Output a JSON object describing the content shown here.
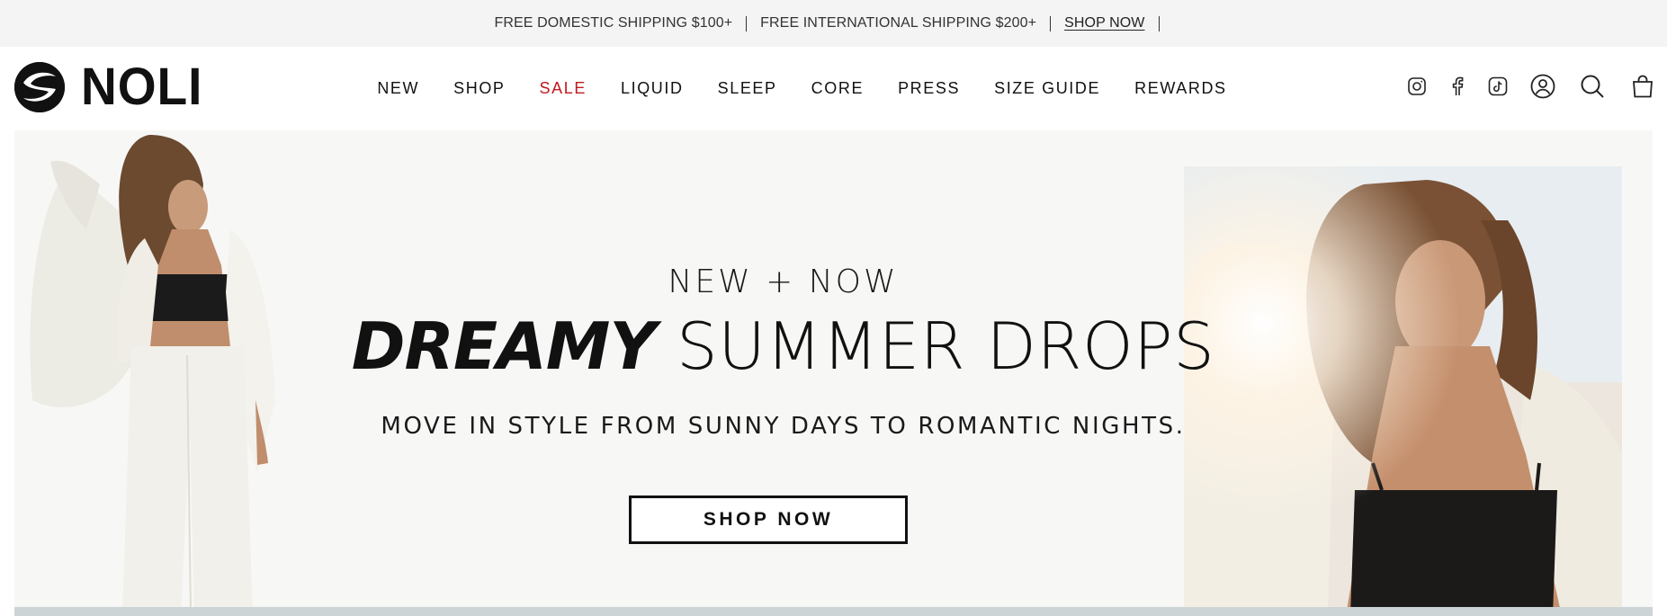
{
  "announcement": {
    "domestic": "FREE DOMESTIC SHIPPING $100+",
    "international": "FREE INTERNATIONAL SHIPPING $200+",
    "link": "SHOP NOW"
  },
  "header": {
    "logo_text": "NOLI",
    "nav": [
      "NEW",
      "SHOP",
      "SALE",
      "LIQUID",
      "SLEEP",
      "CORE",
      "PRESS",
      "SIZE GUIDE",
      "REWARDS"
    ],
    "icons": [
      "instagram-icon",
      "facebook-icon",
      "tiktok-icon",
      "account-icon",
      "search-icon",
      "cart-icon"
    ]
  },
  "hero": {
    "eyebrow": "NEW + NOW",
    "headline_strong": "DREAMY",
    "headline_light": "SUMMER DROPS",
    "subline": "MOVE IN STYLE FROM SUNNY DAYS TO ROMANTIC NIGHTS.",
    "cta": "SHOP NOW"
  },
  "colors": {
    "sale": "#c0191f",
    "announcement_bg": "#f4f4f4",
    "hero_bg": "#f7f7f6",
    "text": "#111111"
  }
}
